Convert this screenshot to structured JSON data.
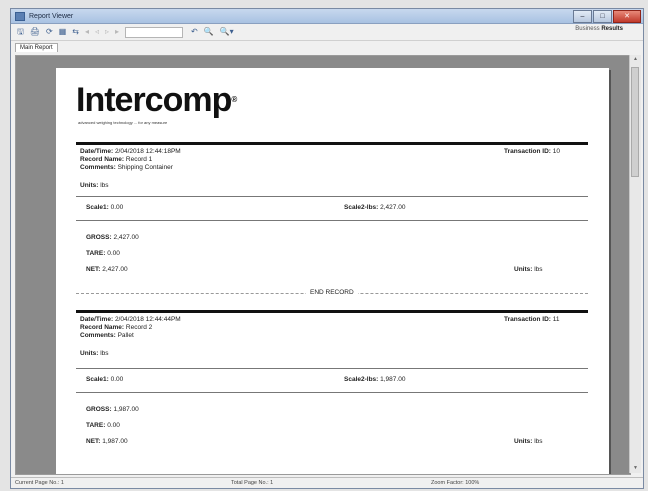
{
  "window": {
    "title": "Report Viewer"
  },
  "toolbar": {
    "buttons": [
      "🖫",
      "🖨",
      "⟳",
      "▦",
      "⇆"
    ],
    "nav": [
      "◂",
      "◃",
      "▹",
      "▸"
    ],
    "search": [
      "↶",
      "🔍",
      "🔍▾"
    ],
    "business_label": "Business",
    "business_value": "Results"
  },
  "tabs": [
    "Main Report"
  ],
  "report": {
    "logo": "Intercomp",
    "tagline": "advanced weighing technology ... for any measure",
    "records": [
      {
        "datetime_label": "Date/Time:",
        "datetime": "2/04/2018 12:44:18PM",
        "record_label": "Record Name:",
        "record_name": "Record 1",
        "comments_label": "Comments:",
        "comments": "Shipping Container",
        "units_label": "Units:",
        "units": "lbs",
        "txn_label": "Transaction ID:",
        "txn": "10",
        "scale1_label": "Scale1:",
        "scale1": "0.00",
        "scale2_label": "Scale2-lbs:",
        "scale2": "2,427.00",
        "gross_label": "GROSS:",
        "gross": "2,427.00",
        "tare_label": "TARE:",
        "tare": "0.00",
        "net_label": "NET:",
        "net": "2,427.00",
        "units2_label": "Units:",
        "units2": "lbs"
      },
      {
        "datetime_label": "Date/Time:",
        "datetime": "2/04/2018 12:44:44PM",
        "record_label": "Record Name:",
        "record_name": "Record 2",
        "comments_label": "Comments:",
        "comments": "Pallet",
        "units_label": "Units:",
        "units": "lbs",
        "txn_label": "Transaction ID:",
        "txn": "11",
        "scale1_label": "Scale1:",
        "scale1": "0.00",
        "scale2_label": "Scale2-lbs:",
        "scale2": "1,987.00",
        "gross_label": "GROSS:",
        "gross": "1,987.00",
        "tare_label": "TARE:",
        "tare": "0.00",
        "net_label": "NET:",
        "net": "1,987.00",
        "units2_label": "Units:",
        "units2": "lbs"
      }
    ],
    "end_record": "END RECORD"
  },
  "status": {
    "current_page": "Current Page No.: 1",
    "total_page": "Total Page No.: 1",
    "zoom": "Zoom Factor: 100%"
  }
}
